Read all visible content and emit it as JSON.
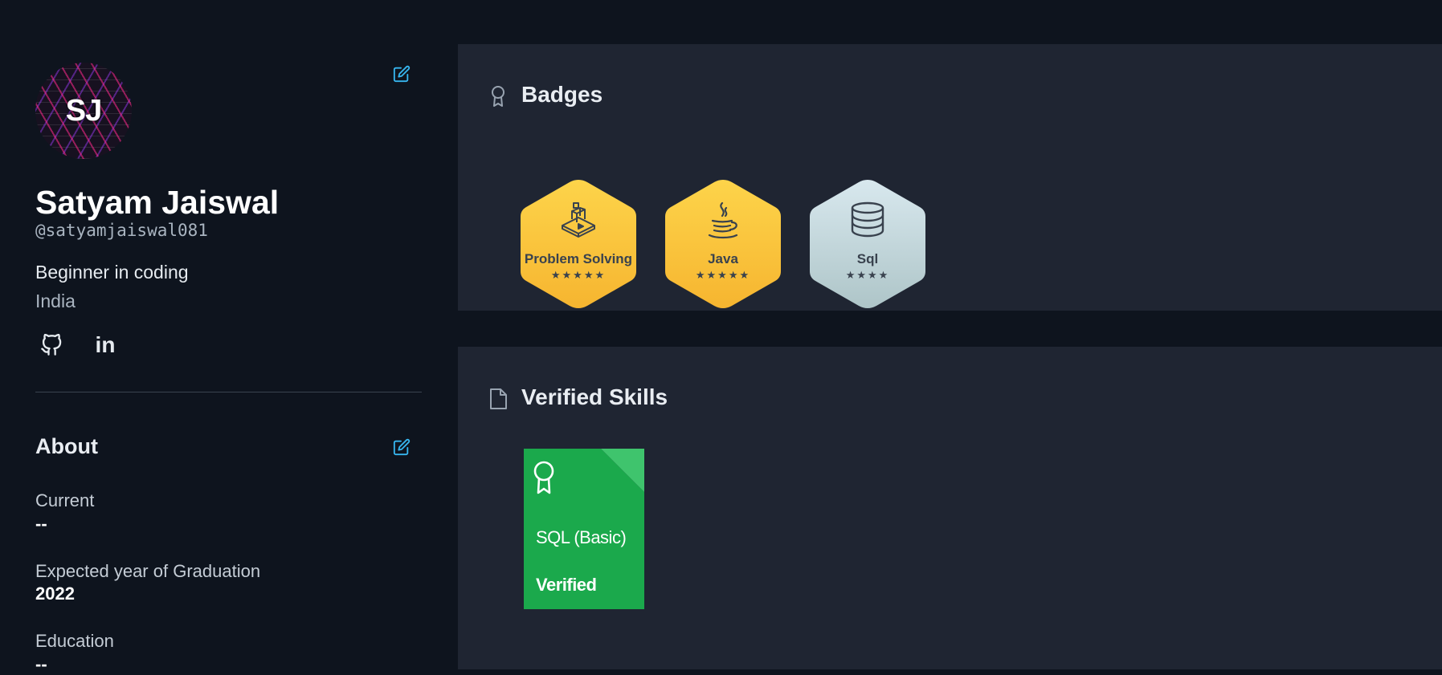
{
  "profile": {
    "avatar_initials": "SJ",
    "name": "Satyam Jaiswal",
    "handle": "@satyamjaiswal081",
    "bio": "Beginner in coding",
    "country": "India"
  },
  "social": {
    "github_icon": "github-icon",
    "linkedin_label": "in"
  },
  "about": {
    "title": "About",
    "current_label": "Current",
    "current_value": "--",
    "graduation_label": "Expected year of Graduation",
    "graduation_value": "2022",
    "education_label": "Education",
    "education_value": "--"
  },
  "badges": {
    "title": "Badges",
    "items": [
      {
        "name": "Problem Solving",
        "stars": "★★★★★",
        "icon": "blocks-icon",
        "tier": "gold"
      },
      {
        "name": "Java",
        "stars": "★★★★★",
        "icon": "java-cup-icon",
        "tier": "gold"
      },
      {
        "name": "Sql",
        "stars": "★★★★",
        "icon": "database-icon",
        "tier": "silver"
      }
    ]
  },
  "skills": {
    "title": "Verified Skills",
    "items": [
      {
        "name": "SQL (Basic)",
        "status": "Verified",
        "icon": "certificate-ribbon-icon"
      }
    ]
  },
  "colors": {
    "page_bg": "#0e141e",
    "card_bg": "#1f2532",
    "accent": "#37b6f0",
    "gold": "#f8c535",
    "silver": "#c9dde2",
    "verified_green": "#1ba94c"
  }
}
